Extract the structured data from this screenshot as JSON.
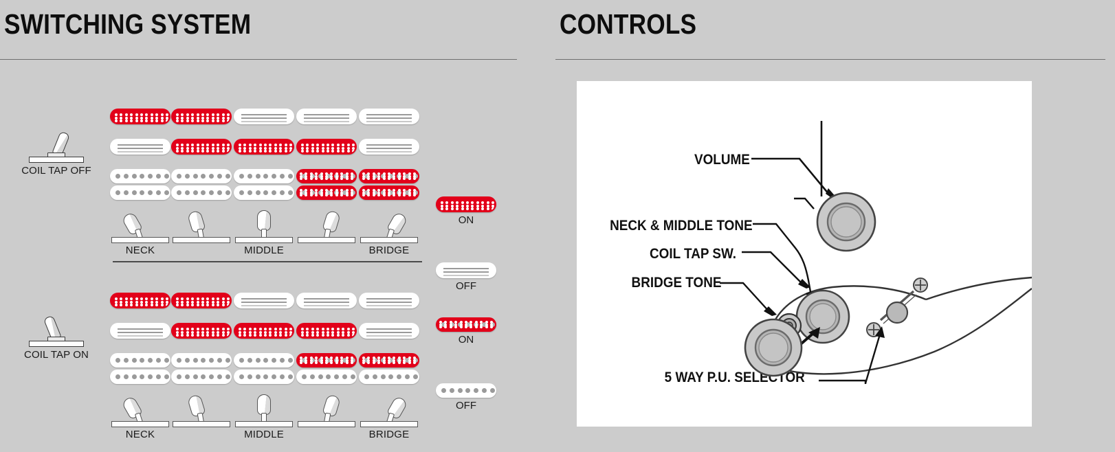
{
  "panels": {
    "left": {
      "title": "SWITCHING SYSTEM"
    },
    "right": {
      "title": "CONTROLS"
    }
  },
  "colors": {
    "page_background": "#cccccc",
    "active_pickup_red": "#e2001a",
    "inactive_pickup_white": "#ffffff",
    "pole_gray": "#9a9a9a",
    "text": "#111111",
    "card_white": "#ffffff",
    "rule_gray": "#6f6f6f"
  },
  "switching": {
    "position_labels": [
      "NECK",
      "",
      "MIDDLE",
      "",
      "BRIDGE"
    ],
    "sections": [
      {
        "id": "coil-tap-off",
        "tap_label": "COIL TAP OFF",
        "tap_switch_state": "off",
        "tap_lever_direction": "lean-right",
        "rows": [
          {
            "type": "single",
            "name": "neck-single",
            "states": [
              "on",
              "on",
              "off",
              "off",
              "off"
            ]
          },
          {
            "type": "single",
            "name": "middle-single",
            "states": [
              "off",
              "on",
              "on",
              "on",
              "off"
            ]
          },
          {
            "type": "humbucker",
            "name": "bridge-humbucker",
            "states": [
              "off",
              "off",
              "off",
              "on",
              "on"
            ],
            "coils": "both"
          }
        ],
        "legend": [
          {
            "type": "single",
            "state": "on",
            "caption": "ON"
          },
          {
            "type": "single",
            "state": "off",
            "caption": "OFF"
          }
        ]
      },
      {
        "id": "coil-tap-on",
        "tap_label": "COIL TAP ON",
        "tap_switch_state": "on",
        "tap_lever_direction": "lean-left",
        "rows": [
          {
            "type": "single",
            "name": "neck-single",
            "states": [
              "on",
              "on",
              "off",
              "off",
              "off"
            ]
          },
          {
            "type": "single",
            "name": "middle-single",
            "states": [
              "off",
              "on",
              "on",
              "on",
              "off"
            ]
          },
          {
            "type": "humbucker",
            "name": "bridge-humbucker",
            "states": [
              "off",
              "off",
              "off",
              "on",
              "on"
            ],
            "coils": "top-only"
          }
        ],
        "legend": [
          {
            "type": "humbucker-coil",
            "state": "on",
            "caption": "ON"
          },
          {
            "type": "humbucker-coil",
            "state": "off",
            "caption": "OFF"
          }
        ]
      }
    ]
  },
  "controls": {
    "labels": [
      {
        "id": "volume",
        "text": "VOLUME"
      },
      {
        "id": "neck-middle-tone",
        "text": "NECK & MIDDLE TONE"
      },
      {
        "id": "coil-tap-sw",
        "text": "COIL TAP SW."
      },
      {
        "id": "bridge-tone",
        "text": "BRIDGE TONE"
      },
      {
        "id": "five-way-selector",
        "text": "5 WAY P.U. SELECTOR"
      }
    ],
    "knobs": [
      {
        "id": "volume-knob",
        "points_to": "VOLUME"
      },
      {
        "id": "neck-middle-tone-knob",
        "points_to": "NECK & MIDDLE TONE"
      },
      {
        "id": "bridge-tone-knob",
        "points_to": "BRIDGE TONE"
      }
    ],
    "mini_switch": {
      "id": "coil-tap-mini-switch",
      "has_double_arrow": true
    },
    "selector_switch": {
      "id": "five-way-lever-switch",
      "screw_count": 2
    }
  }
}
